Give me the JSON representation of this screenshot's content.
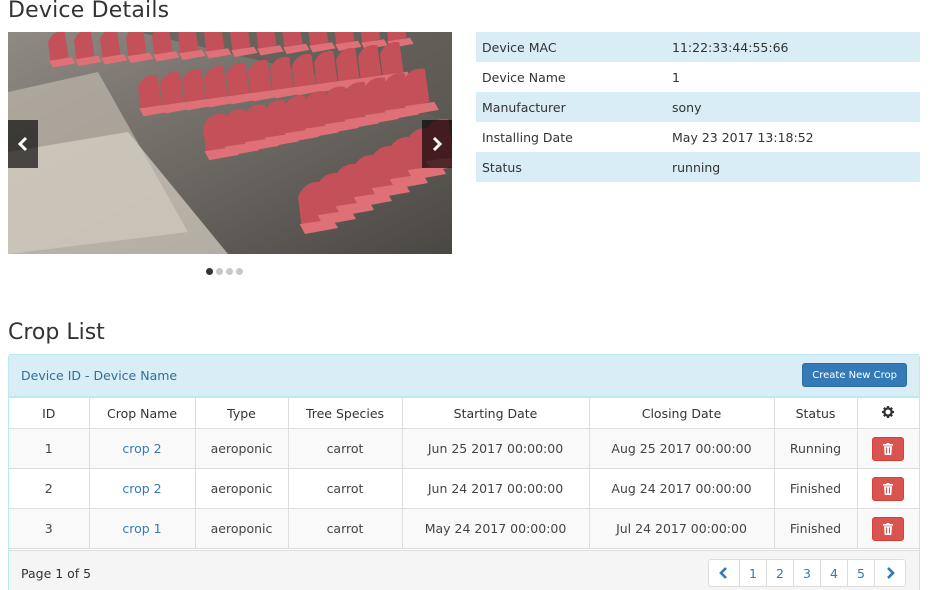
{
  "device_details": {
    "title": "Device Details",
    "carousel": {
      "prev_icon": "chevron-left-icon",
      "next_icon": "chevron-right-icon",
      "slides": 4,
      "active_slide": 1
    },
    "rows": [
      {
        "label": "Device MAC",
        "value": "11:22:33:44:55:66"
      },
      {
        "label": "Device Name",
        "value": "1"
      },
      {
        "label": "Manufacturer",
        "value": "sony"
      },
      {
        "label": "Installing Date",
        "value": "May 23 2017 13:18:52"
      },
      {
        "label": "Status",
        "value": "running"
      }
    ]
  },
  "crop_list": {
    "title": "Crop List",
    "panel_heading": "Device ID - Device Name",
    "create_button": "Create New Crop",
    "columns": [
      "ID",
      "Crop Name",
      "Type",
      "Tree Species",
      "Starting Date",
      "Closing Date",
      "Status"
    ],
    "settings_icon": "gear-icon",
    "rows": [
      {
        "id": "1",
        "crop_name": "crop 2",
        "type": "aeroponic",
        "species": "carrot",
        "start": "Jun 25 2017 00:00:00",
        "close": "Aug 25 2017 00:00:00",
        "status": "Running"
      },
      {
        "id": "2",
        "crop_name": "crop 2",
        "type": "aeroponic",
        "species": "carrot",
        "start": "Jun 24 2017 00:00:00",
        "close": "Aug 24 2017 00:00:00",
        "status": "Finished"
      },
      {
        "id": "3",
        "crop_name": "crop 1",
        "type": "aeroponic",
        "species": "carrot",
        "start": "May 24 2017 00:00:00",
        "close": "Jul 24 2017 00:00:00",
        "status": "Finished"
      }
    ],
    "delete_icon": "trash-icon",
    "page_info": "Page 1 of 5",
    "pagination": {
      "prev_icon": "chevron-left-icon",
      "pages": [
        "1",
        "2",
        "3",
        "4",
        "5"
      ],
      "next_icon": "chevron-right-icon"
    }
  },
  "colors": {
    "accent": "#337ab7",
    "info_bg": "#d9edf7",
    "danger": "#d9534f"
  }
}
